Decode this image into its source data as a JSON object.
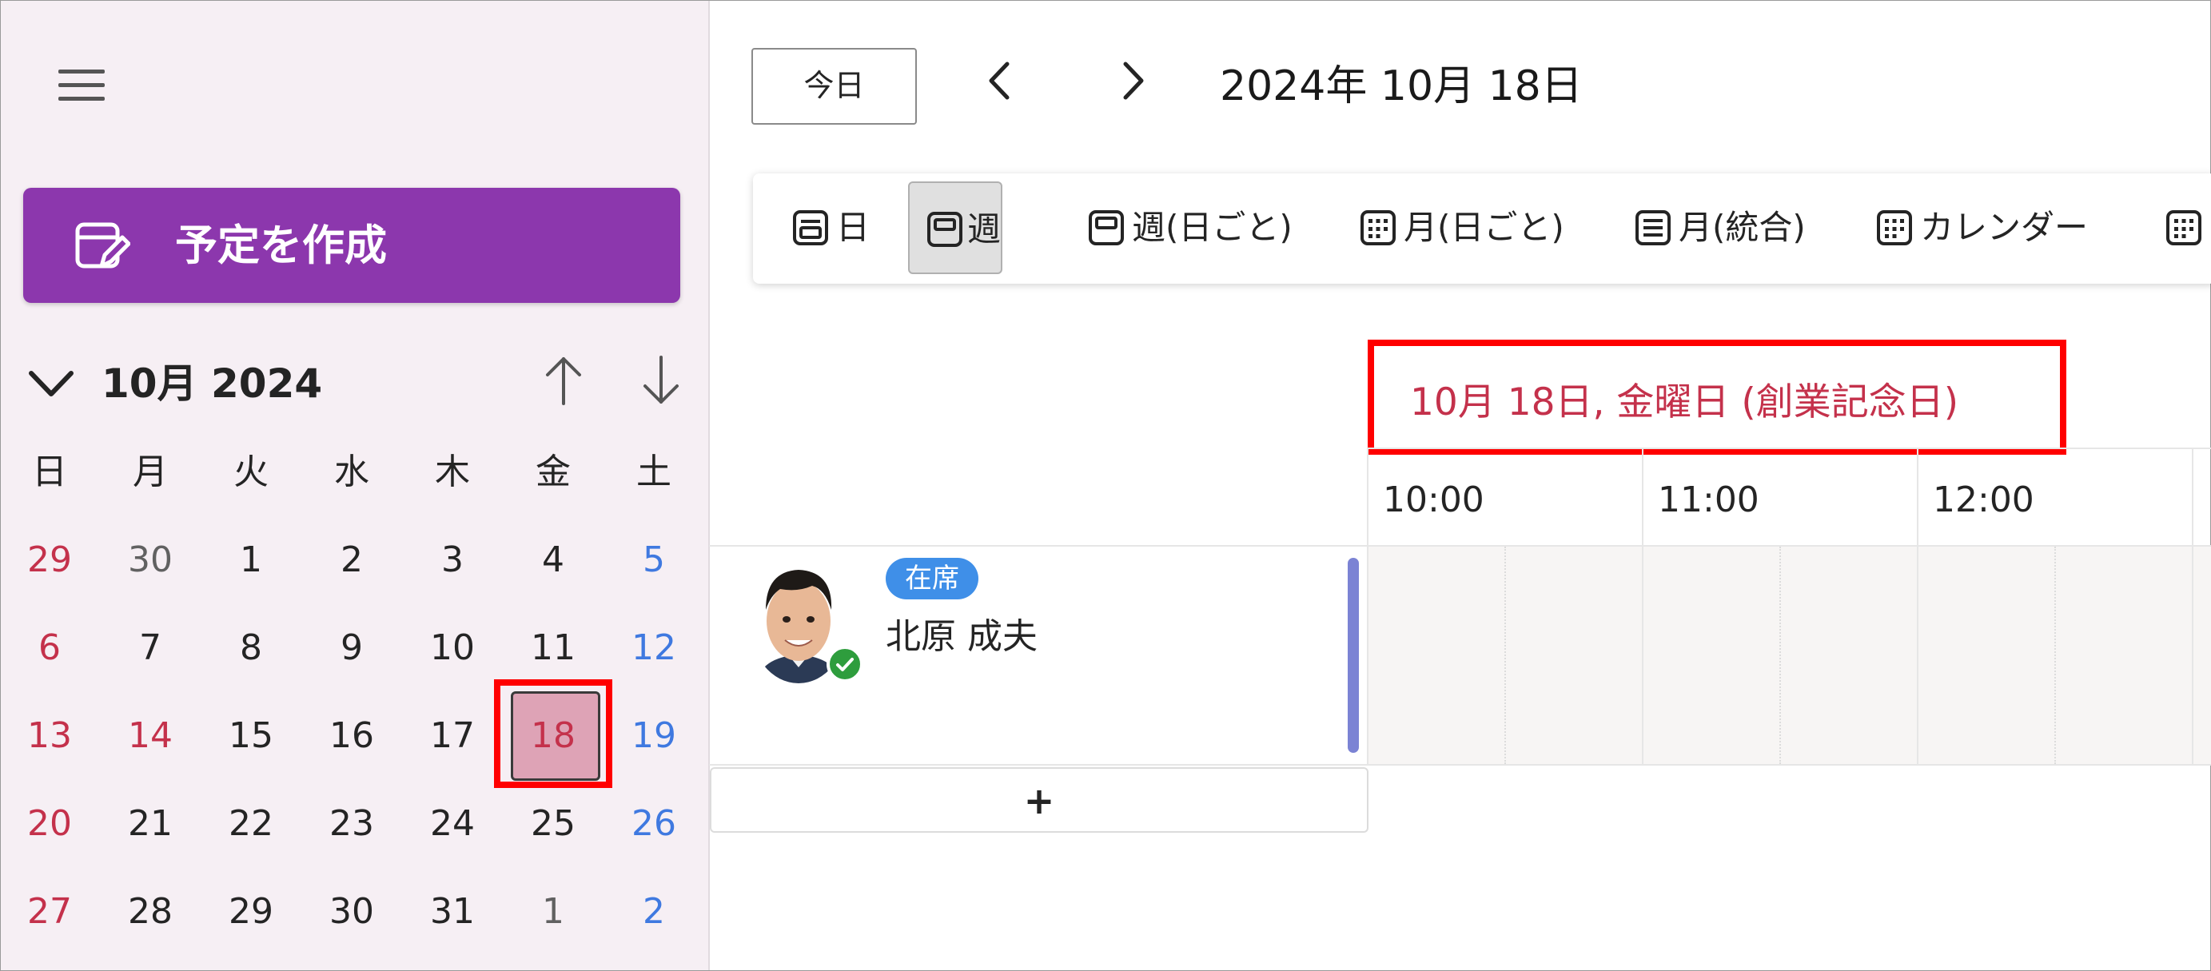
{
  "sidebar": {
    "create_label": "予定を作成",
    "mini_calendar": {
      "title": "10月 2024",
      "weekdays": [
        "日",
        "月",
        "火",
        "水",
        "木",
        "金",
        "土"
      ],
      "weeks": [
        [
          "29",
          "30",
          "1",
          "2",
          "3",
          "4",
          "5"
        ],
        [
          "6",
          "7",
          "8",
          "9",
          "10",
          "11",
          "12"
        ],
        [
          "13",
          "14",
          "15",
          "16",
          "17",
          "18",
          "19"
        ],
        [
          "20",
          "21",
          "22",
          "23",
          "24",
          "25",
          "26"
        ],
        [
          "27",
          "28",
          "29",
          "30",
          "31",
          "1",
          "2"
        ]
      ],
      "selected_day": "18"
    }
  },
  "header": {
    "today_label": "今日",
    "date_title": "2024年 10月 18日"
  },
  "toolbar": {
    "views": [
      {
        "label": "日",
        "icon": "day-view-icon"
      },
      {
        "label": "週",
        "icon": "week-view-icon"
      },
      {
        "label": "週(日ごと)",
        "icon": "week-by-day-icon"
      },
      {
        "label": "月(日ごと)",
        "icon": "month-by-day-icon"
      },
      {
        "label": "月(統合)",
        "icon": "month-combined-icon"
      },
      {
        "label": "カレンダー",
        "icon": "calendar-view-icon"
      }
    ],
    "active_view": "週"
  },
  "schedule": {
    "day_header": "10月 18日, 金曜日 (創業記念日)",
    "time_labels": [
      "10:00",
      "11:00",
      "12:00"
    ],
    "person": {
      "name": "北原 成夫",
      "status_badge": "在席"
    },
    "add_label": "+"
  },
  "colors": {
    "accent": "#8c37ad",
    "holiday": "#c4314b",
    "saturday": "#3f79e0",
    "selected_day_bg": "#dea3b6",
    "status_badge": "#3f8fe8",
    "presence_ok": "#2e9d3d"
  }
}
